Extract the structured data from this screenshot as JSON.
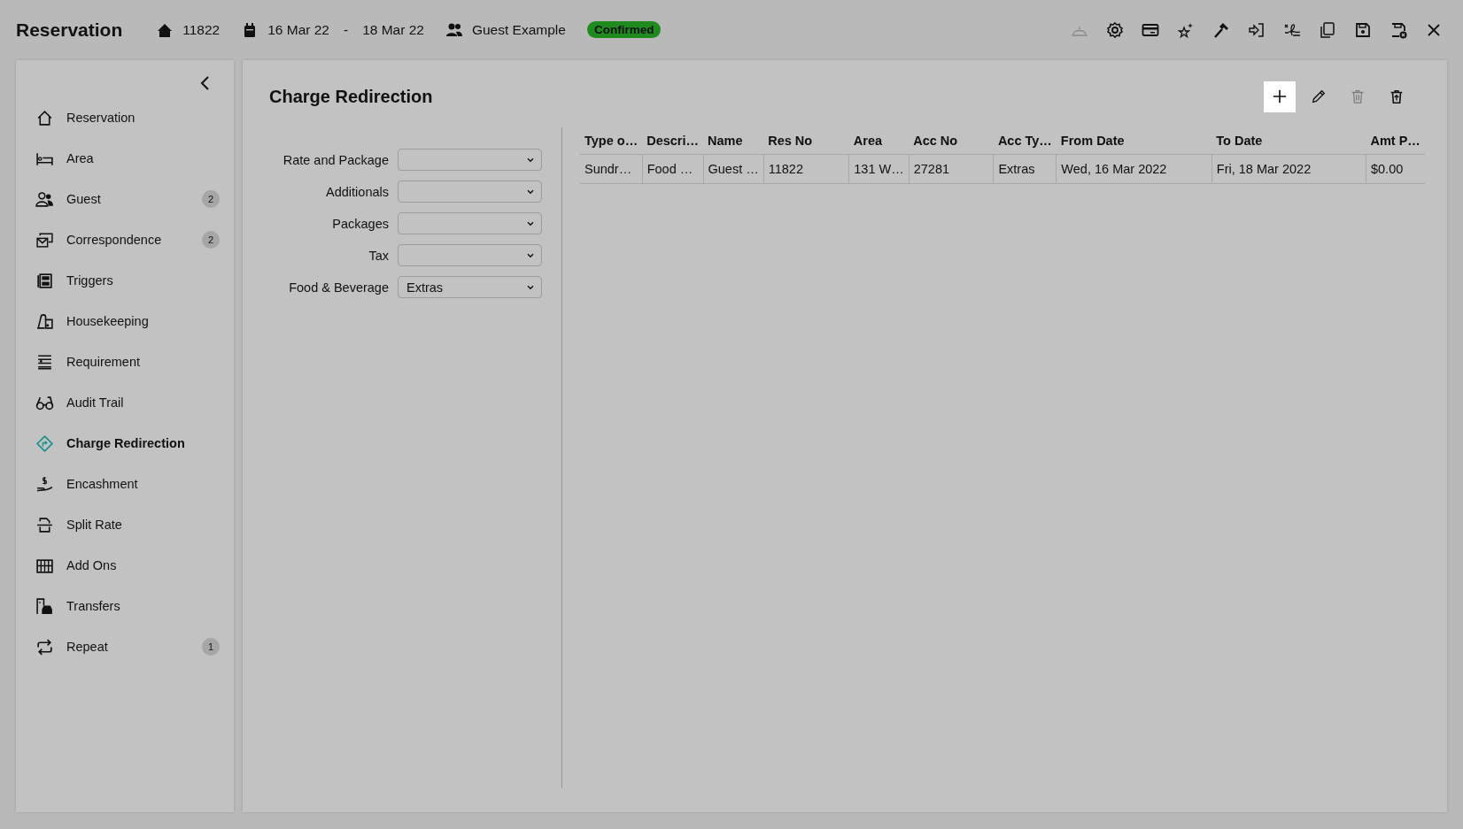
{
  "header": {
    "title": "Reservation",
    "res_no": "11822",
    "date_from": "16 Mar 22",
    "date_sep": "-",
    "date_to": "18 Mar 22",
    "guest": "Guest Example",
    "status": "Confirmed",
    "tools": [
      {
        "kind": "bell",
        "disabled": true
      },
      {
        "kind": "gear",
        "disabled": false
      },
      {
        "kind": "card",
        "disabled": false
      },
      {
        "kind": "stars",
        "disabled": false
      },
      {
        "kind": "hammer",
        "disabled": false
      },
      {
        "kind": "signin",
        "disabled": false
      },
      {
        "kind": "signature",
        "disabled": false
      },
      {
        "kind": "copy",
        "disabled": false
      },
      {
        "kind": "save",
        "disabled": false
      },
      {
        "kind": "saveclose",
        "disabled": false
      },
      {
        "kind": "close",
        "disabled": false
      }
    ]
  },
  "sidebar": {
    "items": [
      {
        "kind": "home",
        "label": "Reservation",
        "selected": false
      },
      {
        "kind": "bed",
        "label": "Area",
        "selected": false
      },
      {
        "kind": "people",
        "label": "Guest",
        "badge": "2",
        "selected": false
      },
      {
        "kind": "mail",
        "label": "Correspondence",
        "badge": "2",
        "selected": false
      },
      {
        "kind": "trigger",
        "label": "Triggers",
        "selected": false
      },
      {
        "kind": "clean",
        "label": "Housekeeping",
        "selected": false
      },
      {
        "kind": "list",
        "label": "Requirement",
        "selected": false
      },
      {
        "kind": "glasses",
        "label": "Audit Trail",
        "selected": false
      },
      {
        "kind": "redirect",
        "label": "Charge Redirection",
        "selected": true
      },
      {
        "kind": "cash",
        "label": "Encashment",
        "selected": false
      },
      {
        "kind": "split",
        "label": "Split Rate",
        "selected": false
      },
      {
        "kind": "grid",
        "label": "Add Ons",
        "selected": false
      },
      {
        "kind": "car",
        "label": "Transfers",
        "selected": false
      },
      {
        "kind": "repeat",
        "label": "Repeat",
        "badge": "1",
        "selected": false
      }
    ]
  },
  "main": {
    "title": "Charge Redirection",
    "actions": [
      {
        "kind": "add",
        "disabled": false,
        "focused": true
      },
      {
        "kind": "edit",
        "disabled": false,
        "focused": false
      },
      {
        "kind": "delete",
        "disabled": true,
        "focused": false
      },
      {
        "kind": "restore",
        "disabled": false,
        "focused": false
      }
    ],
    "filters": [
      {
        "label": "Rate and Package"
      },
      {
        "label": "Additionals"
      },
      {
        "label": "Packages"
      },
      {
        "label": "Tax"
      },
      {
        "label": "Food & Beverage",
        "value": "Extras"
      }
    ],
    "table": {
      "columns": [
        "Type o…",
        "Descri…",
        "Name",
        "Res No",
        "Area",
        "Acc No",
        "Acc Ty…",
        "From Date",
        "To Date",
        "Amt P…"
      ],
      "rows": [
        [
          "Sundr…",
          "Food …",
          "Guest …",
          "11822",
          "131 W…",
          "27281",
          "Extras",
          "Wed, 16 Mar 2022",
          "Fri, 18 Mar 2022",
          "$0.00"
        ]
      ]
    }
  }
}
